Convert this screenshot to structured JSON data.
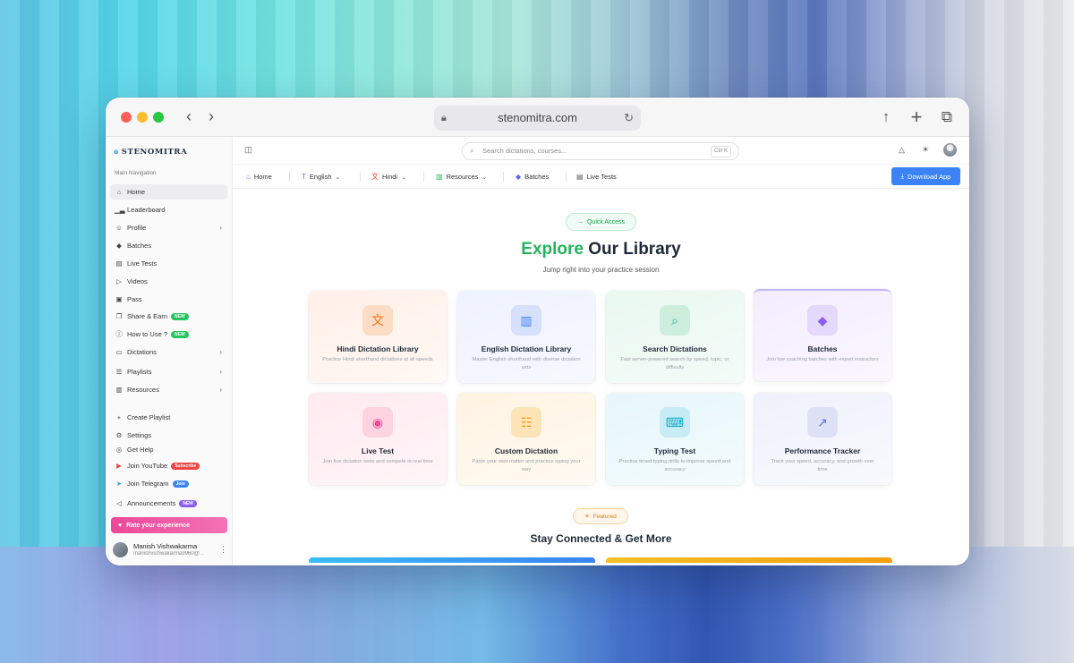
{
  "browser": {
    "url": "stenomitra.com"
  },
  "sidebar": {
    "brand": "STENOMITRA",
    "section_label": "Main Navigation",
    "items": [
      {
        "label": "Home",
        "icon": "home-icon"
      },
      {
        "label": "Leaderboard",
        "icon": "chart-icon"
      },
      {
        "label": "Profile",
        "icon": "user-icon"
      },
      {
        "label": "Batches",
        "icon": "graduation-cap-icon"
      },
      {
        "label": "Live Tests",
        "icon": "clipboard-icon"
      },
      {
        "label": "Videos",
        "icon": "play-icon"
      },
      {
        "label": "Pass",
        "icon": "ticket-icon"
      },
      {
        "label": "Share & Earn",
        "icon": "gift-icon",
        "badge": "NEW"
      },
      {
        "label": "How to Use ?",
        "icon": "help-icon",
        "badge": "NEW"
      },
      {
        "label": "Dictations",
        "icon": "mic-icon"
      },
      {
        "label": "Playlists",
        "icon": "list-icon"
      },
      {
        "label": "Resources",
        "icon": "book-icon"
      },
      {
        "label": "Create Playlist",
        "icon": "plus-icon"
      },
      {
        "label": "Settings",
        "icon": "gear-icon"
      },
      {
        "label": "Get Help",
        "icon": "lifebuoy-icon"
      },
      {
        "label": "Join YouTube",
        "icon": "youtube-icon",
        "badge": "Subscribe"
      },
      {
        "label": "Join Telegram",
        "icon": "telegram-icon",
        "badge": "Join"
      },
      {
        "label": "Announcements",
        "icon": "megaphone-icon",
        "badge": "NEW"
      }
    ],
    "rate_label": "Rate your experience",
    "user": {
      "name": "Manish Vishwakarma",
      "email": "manishvishwakarma9960@..."
    }
  },
  "header": {
    "search_placeholder": "Search dictations, courses...",
    "shortcut": "Ctrl K"
  },
  "menubar": {
    "items": [
      {
        "label": "Home"
      },
      {
        "label": "English"
      },
      {
        "label": "Hindi"
      },
      {
        "label": "Resources"
      },
      {
        "label": "Batches"
      },
      {
        "label": "Live Tests"
      }
    ],
    "download_label": "Download App"
  },
  "main": {
    "quick_access": "Quick Access",
    "title_accent": "Explore",
    "title_rest": " Our Library",
    "subtitle": "Jump right into your practice session",
    "cards": [
      {
        "title": "Hindi Dictation Library",
        "desc": "Practice Hindi shorthand dictations at all speeds",
        "icon": "translate-icon"
      },
      {
        "title": "English Dictation Library",
        "desc": "Master English shorthand with diverse dictation sets",
        "icon": "book-open-icon"
      },
      {
        "title": "Search Dictations",
        "desc": "Fast server-powered search by speed, topic, or difficulty",
        "icon": "search-icon"
      },
      {
        "title": "Batches",
        "desc": "Join live coaching batches with expert instructors",
        "icon": "graduation-cap-icon"
      },
      {
        "title": "Live Test",
        "desc": "Join live dictation tests and compete in real time",
        "icon": "broadcast-icon"
      },
      {
        "title": "Custom Dictation",
        "desc": "Paste your own matter and practice typing your way",
        "icon": "document-icon"
      },
      {
        "title": "Typing Test",
        "desc": "Practice timed typing drills to improve speed and accuracy",
        "icon": "keyboard-icon"
      },
      {
        "title": "Performance Tracker",
        "desc": "Track your speed, accuracy, and growth over time",
        "icon": "trend-chart-icon"
      }
    ],
    "featured": "Featured",
    "section_title": "Stay Connected & Get More"
  },
  "colors": {
    "accent_green": "#22b35a",
    "primary_blue": "#3b82f6",
    "pink": "#ec4899"
  }
}
